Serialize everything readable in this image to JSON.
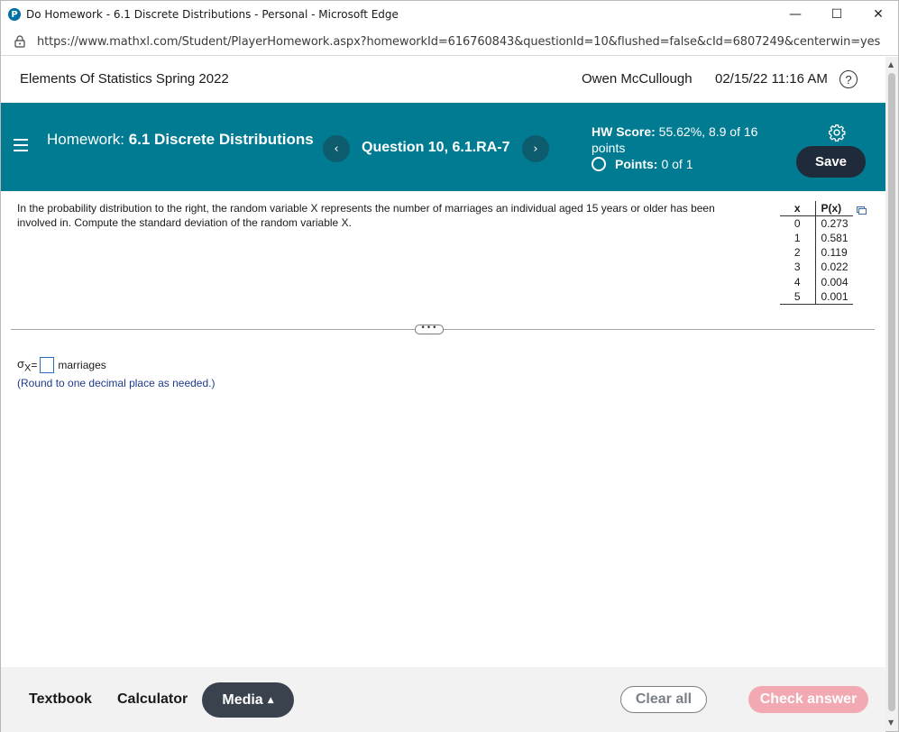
{
  "window": {
    "title": "Do Homework - 6.1 Discrete Distributions - Personal - Microsoft Edge",
    "logo_letter": "P",
    "minimize_glyph": "—",
    "maximize_glyph": "☐",
    "close_glyph": "✕"
  },
  "address": {
    "url": "https://www.mathxl.com/Student/PlayerHomework.aspx?homeworkId=616760843&questionId=10&flushed=false&cId=6807249&centerwin=yes"
  },
  "course": {
    "title": "Elements Of Statistics Spring 2022",
    "user": "Owen McCullough",
    "datetime": "02/15/22 11:16 AM",
    "help_glyph": "?"
  },
  "homework": {
    "prefix": "Homework: ",
    "name": "6.1 Discrete Distributions",
    "question": "Question 10, 6.1.RA-7",
    "prev_glyph": "‹",
    "next_glyph": "›",
    "hw_score_label": "HW Score:",
    "hw_score_value": " 55.62%, 8.9 of 16 points",
    "points_label": "Points:",
    "points_value": "0 of 1",
    "save_label": "Save"
  },
  "question": {
    "text": "In the probability distribution to the right, the random variable X represents the number of marriages an individual aged 15 years or older has been involved in. Compute the standard deviation of the random variable X.",
    "table": {
      "headers": [
        "x",
        "P(x)"
      ],
      "rows": [
        [
          "0",
          "0.273"
        ],
        [
          "1",
          "0.581"
        ],
        [
          "2",
          "0.119"
        ],
        [
          "3",
          "0.022"
        ],
        [
          "4",
          "0.004"
        ],
        [
          "5",
          "0.001"
        ]
      ]
    },
    "more_glyph": "•••",
    "answer_symbol": "σ",
    "answer_subscript": "X",
    "answer_equals": " =",
    "answer_value": "",
    "answer_unit": "marriages",
    "hint": "(Round to one decimal place as needed.)"
  },
  "footer": {
    "textbook": "Textbook",
    "calculator": "Calculator",
    "media": "Media",
    "media_caret": "▲",
    "clear_all": "Clear all",
    "check_answer": "Check answer"
  },
  "colors": {
    "header_teal": "#007b92",
    "nav_circle": "#0d5c6d",
    "save_button": "#1f2b3a",
    "media_button": "#3a424d",
    "check_button": "#f2a9b2",
    "hint_text": "#1e3a8a"
  },
  "icons": [
    "app-logo-icon",
    "lock-icon",
    "help-icon",
    "menu-icon",
    "gear-icon",
    "copy-icon",
    "chevron-left-icon",
    "chevron-right-icon",
    "caret-up-icon"
  ]
}
